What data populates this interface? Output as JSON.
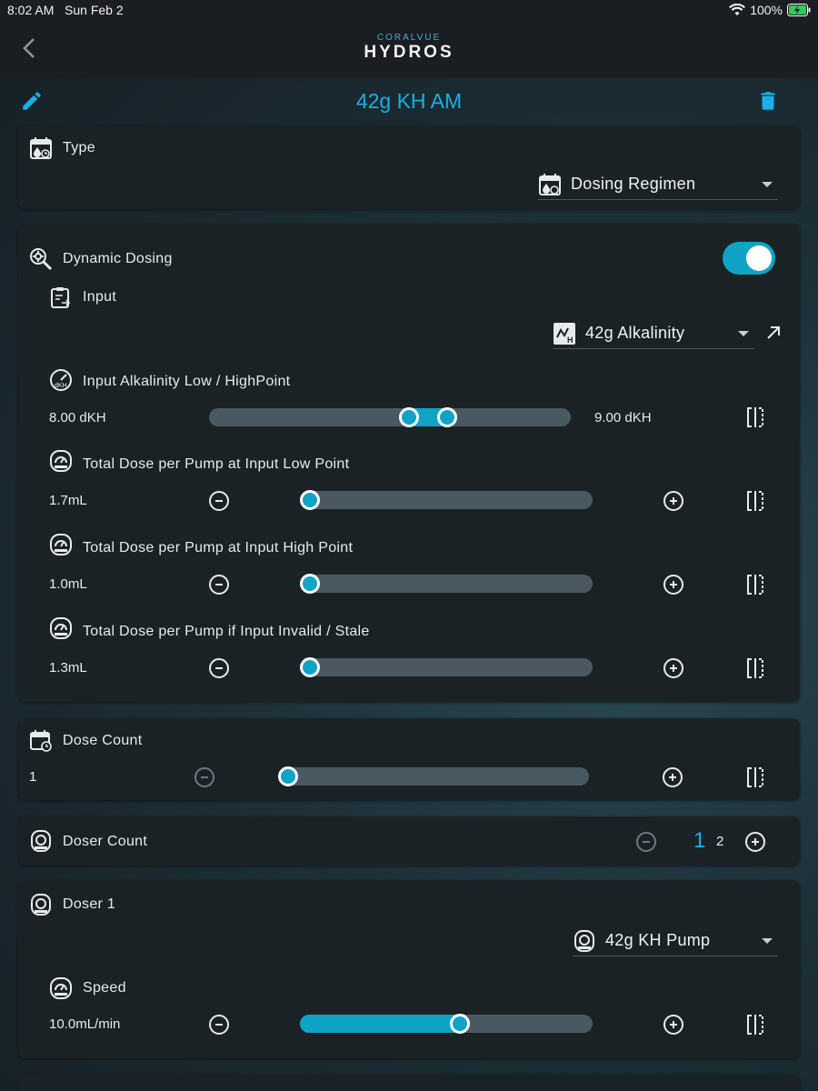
{
  "status_bar": {
    "time": "8:02 AM",
    "date": "Sun Feb 2",
    "battery": "100%"
  },
  "nav": {
    "logo_small": "CORALVUE",
    "logo_main": "HYDROS"
  },
  "page_title": "42g KH AM",
  "type_card": {
    "label": "Type",
    "value": "Dosing Regimen"
  },
  "dynamic_card": {
    "label": "Dynamic Dosing",
    "enabled": true,
    "input_label": "Input",
    "input_value": "42g Alkalinity",
    "range_label": "Input  Alkalinity Low / HighPoint",
    "low_value": "8.00 dKH",
    "high_value": "9.00 dKH",
    "range_fraction": [
      0.556,
      0.667
    ],
    "rows": [
      {
        "label": "Total Dose per Pump at Input Low Point",
        "value": "1.7mL",
        "fraction": 0.0
      },
      {
        "label": "Total Dose per Pump at Input High Point",
        "value": "1.0mL",
        "fraction": 0.0
      },
      {
        "label": "Total Dose per Pump if Input Invalid / Stale",
        "value": "1.3mL",
        "fraction": 0.0
      }
    ]
  },
  "dose_count": {
    "label": "Dose Count",
    "value": "1",
    "fraction": 0.0
  },
  "doser_count": {
    "label": "Doser Count",
    "selected": "1",
    "other": "2"
  },
  "doser1": {
    "label": "Doser 1",
    "pump": "42g KH Pump",
    "speed_label": "Speed",
    "speed_value": "10.0mL/min",
    "fraction": 0.55
  },
  "colors": {
    "accent": "#0fa3c6",
    "title": "#18aee6",
    "track": "#4a5961"
  },
  "icons": [
    "back-chevron-icon",
    "edit-pencil-icon",
    "trash-icon",
    "calendar-dosing-icon",
    "search-gear-icon",
    "clipboard-input-icon",
    "kh-probe-icon",
    "external-link-icon",
    "gauge-icon",
    "pump-icon",
    "split-adjust-icon",
    "minus-circle-icon",
    "plus-circle-icon"
  ]
}
